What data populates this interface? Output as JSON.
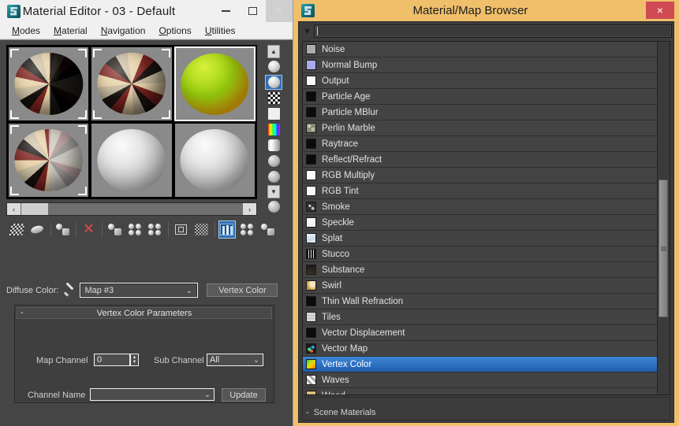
{
  "material_editor": {
    "title": "Material Editor - 03 - Default",
    "logo_icon": "max-logo-icon",
    "window_controls": {
      "minimize": "minimize-icon",
      "maximize": "maximize-icon",
      "close": "close-icon"
    },
    "menus": [
      {
        "label": "Modes",
        "mnemonic": "M"
      },
      {
        "label": "Material",
        "mnemonic": "M"
      },
      {
        "label": "Navigation",
        "mnemonic": "N"
      },
      {
        "label": "Options",
        "mnemonic": "O"
      },
      {
        "label": "Utilities",
        "mnemonic": "U"
      }
    ],
    "slots": [
      {
        "name": "slot-1",
        "style": "sph-half-dark",
        "active": false,
        "corners": true
      },
      {
        "name": "slot-2",
        "style": "sph-check",
        "active": false,
        "corners": true
      },
      {
        "name": "slot-3",
        "style": "sph-green",
        "active": true,
        "corners": false
      },
      {
        "name": "slot-4",
        "style": "sph-half-gray",
        "active": false,
        "corners": true
      },
      {
        "name": "slot-5",
        "style": "sph-gray",
        "active": false,
        "corners": false
      },
      {
        "name": "slot-6",
        "style": "sph-gray",
        "active": false,
        "corners": false
      }
    ],
    "sample_toolbar": [
      {
        "name": "sample-type-sphere-icon",
        "glyph": "mini",
        "active": false
      },
      {
        "name": "sample-type-selected-icon",
        "glyph": "mini",
        "active": true
      },
      {
        "name": "backlight-icon",
        "glyph": "mini checker",
        "active": false
      },
      {
        "name": "background-icon",
        "glyph": "mini plain",
        "active": false
      },
      {
        "name": "sample-uv-tiling-icon",
        "glyph": "mini rainbow",
        "active": false
      },
      {
        "name": "video-color-check-icon",
        "glyph": "mini cube",
        "active": false
      },
      {
        "name": "make-preview-icon",
        "glyph": "mini dots",
        "active": false
      },
      {
        "name": "options-icon",
        "glyph": "mini dots",
        "active": false
      },
      {
        "name": "select-by-material-icon",
        "glyph": "mini dots",
        "active": false
      }
    ],
    "hscroll": {
      "left_arrow": "‹",
      "right_arrow": "›"
    },
    "vscroll": {
      "up_arrow": "∧",
      "down_arrow": "∨"
    },
    "main_toolbar": [
      {
        "name": "get-material-button",
        "icon": "ic-checkflag",
        "active": false,
        "sep_after": false
      },
      {
        "name": "assign-material-to-selection-button",
        "icon": "ic-disc",
        "active": false,
        "sep_after": true
      },
      {
        "name": "reset-map-button",
        "icon": "ic-2balls",
        "active": false,
        "sep_after": true
      },
      {
        "name": "delete-material-button",
        "icon": "ic-x",
        "active": false,
        "sep_after": true
      },
      {
        "name": "put-material-to-scene-button",
        "icon": "ic-2balls",
        "active": false,
        "sep_after": false
      },
      {
        "name": "make-material-copy-button",
        "icon": "ic-quad",
        "active": false,
        "sep_after": false
      },
      {
        "name": "make-unique-button",
        "icon": "ic-quad",
        "active": false,
        "sep_after": true
      },
      {
        "name": "put-to-library-button",
        "icon": "ic-box",
        "active": false,
        "sep_after": false
      },
      {
        "name": "material-id-channel-button",
        "icon": "ic-grid",
        "active": false,
        "sep_after": true
      },
      {
        "name": "show-shaded-material-in-viewport-button",
        "icon": "ic-viewport",
        "active": true,
        "sep_after": false
      },
      {
        "name": "show-end-result-button",
        "icon": "ic-quad",
        "active": false,
        "sep_after": false
      },
      {
        "name": "go-to-parent-button",
        "icon": "ic-2balls",
        "active": false,
        "sep_after": false
      }
    ],
    "diffuse_row": {
      "label": "Diffuse Color:",
      "eyedropper_icon": "eyedropper-icon",
      "map_name": "Map #3",
      "dropdown_arrow": "⌄",
      "map_type_button": "Vertex Color"
    },
    "rollout": {
      "title": "Vertex Color Parameters",
      "collapse_glyph": "-",
      "map_channel_label": "Map Channel",
      "map_channel_value": "0",
      "spinner_up": "▲",
      "spinner_down": "▼",
      "sub_channel_label": "Sub Channel",
      "sub_channel_value": "All",
      "sub_channel_arrow": "⌄",
      "channel_name_label": "Channel Name",
      "channel_name_value": "",
      "channel_name_arrow": "⌄",
      "update_button": "Update"
    }
  },
  "map_browser": {
    "title": "Material/Map Browser",
    "logo_icon": "max-logo-icon",
    "close_label": "×",
    "search": {
      "dropdown_icon": "filter-dropdown-icon",
      "value": "",
      "placeholder": ""
    },
    "items": [
      {
        "label": "Noise",
        "swatch": "sw-noise",
        "selected": false
      },
      {
        "label": "Normal Bump",
        "swatch": "sw-normal",
        "selected": false
      },
      {
        "label": "Output",
        "swatch": "sw-white",
        "selected": false
      },
      {
        "label": "Particle Age",
        "swatch": "sw-black",
        "selected": false
      },
      {
        "label": "Particle MBlur",
        "swatch": "sw-black",
        "selected": false
      },
      {
        "label": "Perlin Marble",
        "swatch": "sw-marble",
        "selected": false
      },
      {
        "label": "Raytrace",
        "swatch": "sw-black",
        "selected": false
      },
      {
        "label": "Reflect/Refract",
        "swatch": "sw-black",
        "selected": false
      },
      {
        "label": "RGB Multiply",
        "swatch": "sw-white",
        "selected": false
      },
      {
        "label": "RGB Tint",
        "swatch": "sw-white",
        "selected": false
      },
      {
        "label": "Smoke",
        "swatch": "sw-smoke",
        "selected": false
      },
      {
        "label": "Speckle",
        "swatch": "sw-speckle",
        "selected": false
      },
      {
        "label": "Splat",
        "swatch": "sw-splat",
        "selected": false
      },
      {
        "label": "Stucco",
        "swatch": "sw-stucco",
        "selected": false
      },
      {
        "label": "Substance",
        "swatch": "sw-substance",
        "selected": false
      },
      {
        "label": "Swirl",
        "swatch": "sw-swirl",
        "selected": false
      },
      {
        "label": "Thin Wall Refraction",
        "swatch": "sw-black",
        "selected": false
      },
      {
        "label": "Tiles",
        "swatch": "sw-tiles",
        "selected": false
      },
      {
        "label": "Vector Displacement",
        "swatch": "sw-black",
        "selected": false
      },
      {
        "label": "Vector Map",
        "swatch": "sw-vectormap",
        "selected": false
      },
      {
        "label": "Vertex Color",
        "swatch": "sw-vertexcolor",
        "selected": true
      },
      {
        "label": "Waves",
        "swatch": "sw-waves",
        "selected": false
      },
      {
        "label": "Wood",
        "swatch": "sw-wood",
        "selected": false
      }
    ],
    "scene_materials": {
      "collapse_glyph": "-",
      "label": "Scene Materials"
    }
  },
  "colors": {
    "browser_title_bar": "#f0bf6b",
    "close_button": "#cf4a52",
    "selection_blue": "#2f6fb5",
    "panel_bg": "#454545",
    "list_row_bg": "#434343",
    "menu_bar_bg": "#f0f0f0"
  }
}
